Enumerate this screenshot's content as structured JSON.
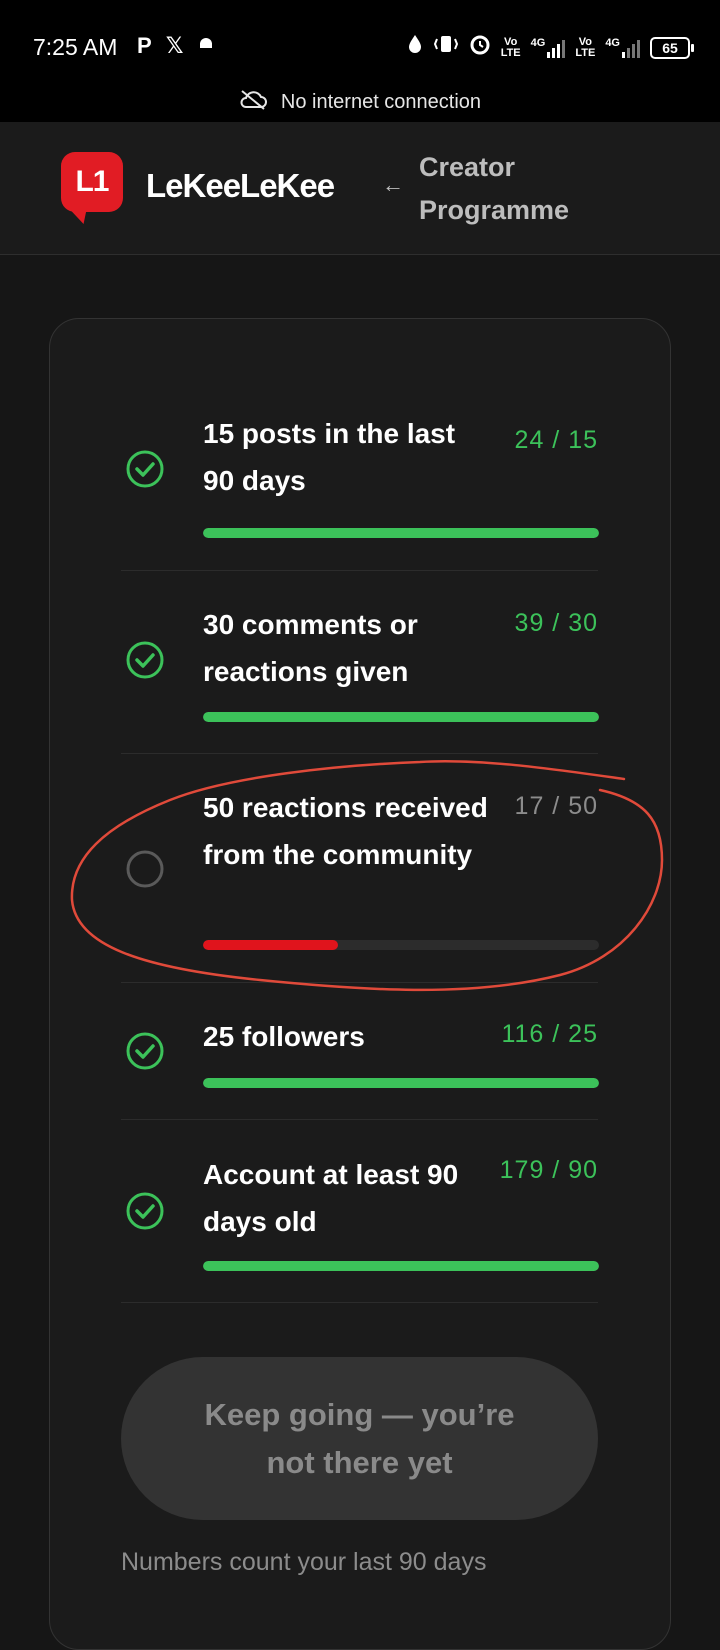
{
  "status_bar": {
    "time": "7:25 AM",
    "left_icons": [
      "p-icon",
      "x-icon",
      "android-icon"
    ],
    "volte_1": "Vo\nLTE",
    "network_1": "4G",
    "volte_2": "Vo\nLTE",
    "network_2": "4G",
    "battery": "65",
    "network_banner": "No internet connection"
  },
  "header": {
    "logo_glyph": "L1",
    "wordmark": "LeKeeLeKee",
    "back_icon": "arrow-left-icon",
    "title": "Creator Programme"
  },
  "requirements": [
    {
      "title": "15 posts in the last 90 days",
      "count": "24 / 15",
      "met": true,
      "progress": 1.0
    },
    {
      "title": "30 comments or reactions given",
      "count": "39 / 30",
      "met": true,
      "progress": 1.0
    },
    {
      "title": "50 reactions received from the community",
      "count": "17 / 50",
      "met": false,
      "progress": 0.34
    },
    {
      "title": "25 followers",
      "count": "116 / 25",
      "met": true,
      "progress": 1.0
    },
    {
      "title": "Account at least 90 days old",
      "count": "179 / 90",
      "met": true,
      "progress": 1.0
    }
  ],
  "cta": {
    "label": "Keep going — you’re not there yet",
    "enabled": false
  },
  "footnote": "Numbers count your last 90 days",
  "colors": {
    "success": "#3cc25a",
    "pending_fill": "#e0141c",
    "annotation": "#e04a3a",
    "brand": "#e11c24"
  }
}
